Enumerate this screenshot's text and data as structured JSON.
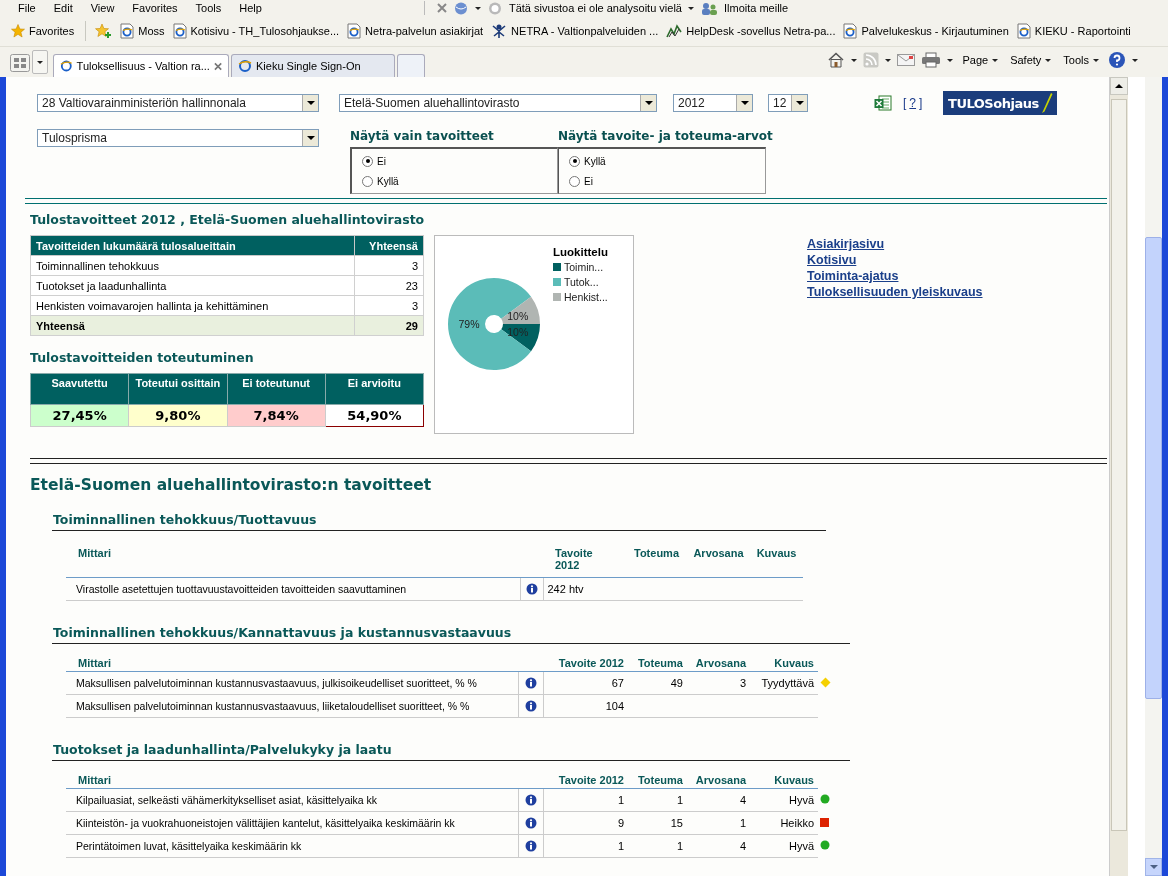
{
  "browser": {
    "menu": [
      "File",
      "Edit",
      "View",
      "Favorites",
      "Tools",
      "Help"
    ],
    "notices": [
      "Tätä sivustoa ei ole analysoitu vielä",
      "Ilmoita meille"
    ],
    "favorites_label": "Favorites",
    "bookmarks": [
      {
        "label": "Moss",
        "kind": "page"
      },
      {
        "label": "Kotisivu - TH_Tulosohjaukse...",
        "kind": "page"
      },
      {
        "label": "Netra-palvelun asiakirjat",
        "kind": "page"
      },
      {
        "label": "NETRA - Valtionpalveluiden ...",
        "kind": "network"
      },
      {
        "label": "HelpDesk -sovellus Netra-pa...",
        "kind": "graph"
      },
      {
        "label": "Palvelukeskus - Kirjautuminen",
        "kind": "page"
      },
      {
        "label": "KIEKU - Raportointi",
        "kind": "page"
      }
    ],
    "tabs": [
      {
        "title": "Tuloksellisuus - Valtion ra...",
        "selected": true
      },
      {
        "title": "Kieku Single Sign-On",
        "selected": false
      }
    ],
    "commands": [
      "Page",
      "Safety",
      "Tools"
    ]
  },
  "filters": {
    "selects": [
      {
        "value": "28 Valtiovarainministeriön hallinnonala",
        "kind": "wide"
      },
      {
        "value": "Etelä-Suomen aluehallintovirasto",
        "kind": "wide2"
      },
      {
        "value": "2012",
        "kind": "year"
      },
      {
        "value": "12",
        "kind": "month"
      }
    ],
    "help": {
      "open": "[",
      "label": "?",
      "close": "]"
    },
    "logo": "TULOSohjaus",
    "view_select": "Tulosprisma",
    "radio_groups": [
      {
        "title": "Näytä vain tavoitteet",
        "options": [
          {
            "label": "Ei",
            "selected": true
          },
          {
            "label": "Kyllä",
            "selected": false
          }
        ]
      },
      {
        "title": "Näytä tavoite- ja toteuma-arvot",
        "options": [
          {
            "label": "Kyllä",
            "selected": true
          },
          {
            "label": "Ei",
            "selected": false
          }
        ]
      }
    ]
  },
  "summary": {
    "title": "Tulostavoitteet 2012 , Etelä-Suomen aluehallintovirasto",
    "table": {
      "columns": [
        "Tavoitteiden lukumäärä tulosalueittain",
        "Yhteensä"
      ],
      "rows": [
        [
          "Toiminnallinen tehokkuus",
          "3"
        ],
        [
          "Tuotokset ja laadunhallinta",
          "23"
        ],
        [
          "Henkisten voimavarojen hallinta ja kehittäminen",
          "3"
        ]
      ],
      "total": [
        "Yhteensä",
        "29"
      ]
    },
    "chart_data": {
      "type": "donut",
      "title": "Luokittelu",
      "categories": [
        "Toimin...",
        "Tutok...",
        "Henkist..."
      ],
      "series": [
        {
          "values": [
            10,
            79,
            10
          ]
        }
      ],
      "value_labels": [
        "10%",
        "79%",
        "10%"
      ],
      "legend": "right"
    },
    "links": [
      "Asiakirjasivu",
      "Kotisivu",
      "Toiminta-ajatus",
      "Tuloksellisuuden yleiskuvaus"
    ],
    "status_title": "Tulostavoitteiden toteutuminen",
    "status": [
      {
        "label": "Saavutettu",
        "value": "27,45%",
        "color": "#ccffcc",
        "selected": false
      },
      {
        "label": "Toteutui osittain",
        "value": "9,80%",
        "color": "#ffffcc",
        "selected": false
      },
      {
        "label": "Ei toteutunut",
        "value": "7,84%",
        "color": "#ffcccc",
        "selected": false
      },
      {
        "label": "Ei arvioitu",
        "value": "54,90%",
        "color": "#ffffff",
        "selected": true
      }
    ]
  },
  "goals": {
    "title": "Etelä-Suomen aluehallintovirasto:n tavoitteet",
    "sections": [
      {
        "title": "Toiminnallinen tehokkuus/Tuottavuus",
        "columns": [
          "Mittari",
          "Tavoite 2012",
          "Toteuma",
          "Arvosana",
          "Kuvaus"
        ],
        "rows": [
          {
            "mittari": "Virastolle asetettujen tuottavuustavoitteiden tavoitteiden saavuttaminen",
            "tavoite": "242 htv"
          }
        ]
      },
      {
        "title": "Toiminnallinen tehokkuus/Kannattavuus ja kustannusvastaavuus",
        "columns": [
          "Mittari",
          "Tavoite 2012",
          "Toteuma",
          "Arvosana",
          "Kuvaus"
        ],
        "rows": [
          {
            "mittari": "Maksullisen palvelutoiminnan kustannusvastaavuus, julkisoikeudelliset suoritteet, %   %",
            "tavoite": "67",
            "toteuma": "49",
            "arvosana": "3",
            "kuvaus": "Tyydyttävä",
            "indicator": {
              "kind": "diamond",
              "color": "#f5d000"
            }
          },
          {
            "mittari": "Maksullisen palvelutoiminnan kustannusvastaavuus, liiketaloudelliset suoritteet, %   %",
            "tavoite": "104"
          }
        ]
      },
      {
        "title": "Tuotokset ja laadunhallinta/Palvelukyky ja laatu",
        "columns": [
          "Mittari",
          "Tavoite 2012",
          "Toteuma",
          "Arvosana",
          "Kuvaus"
        ],
        "rows": [
          {
            "mittari": "Kilpailuasiat, selkeästi vähämerkitykselliset asiat, käsittelyaika   kk",
            "tavoite": "1",
            "toteuma": "1",
            "arvosana": "4",
            "kuvaus": "Hyvä",
            "indicator": {
              "kind": "circle",
              "color": "#22aa22"
            }
          },
          {
            "mittari": "Kiinteistön- ja vuokrahuoneistojen välittäjien kantelut, käsittelyaika keskimäärin   kk",
            "tavoite": "9",
            "toteuma": "15",
            "arvosana": "1",
            "kuvaus": "Heikko",
            "indicator": {
              "kind": "square",
              "color": "#dd2200"
            }
          },
          {
            "mittari": "Perintätoimen luvat, käsittelyaika keskimäärin   kk",
            "tavoite": "1",
            "toteuma": "1",
            "arvosana": "4",
            "kuvaus": "Hyvä",
            "indicator": {
              "kind": "circle",
              "color": "#22aa22"
            }
          }
        ]
      }
    ]
  }
}
